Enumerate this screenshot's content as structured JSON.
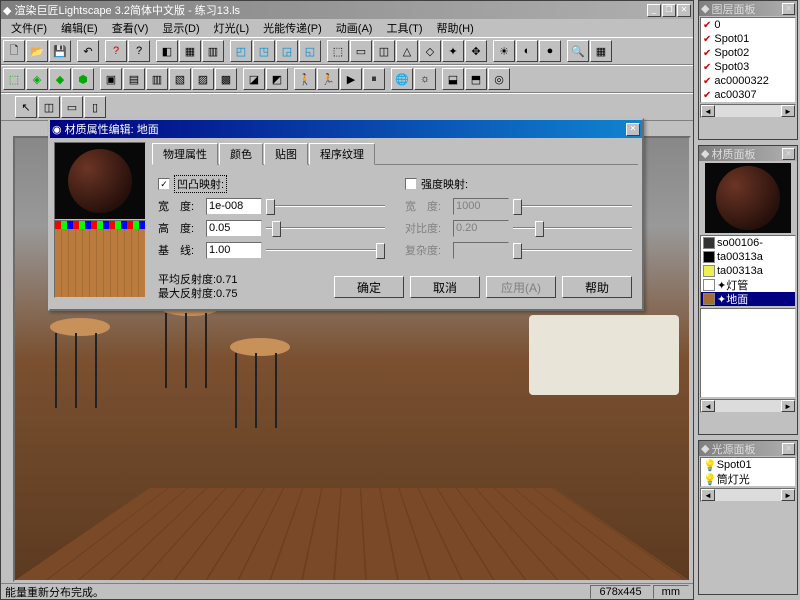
{
  "main": {
    "title": "渲染巨匠Lightscape 3.2简体中文版 - 练习13.ls",
    "menus": [
      "文件(F)",
      "编辑(E)",
      "查看(V)",
      "显示(D)",
      "灯光(L)",
      "光能传递(P)",
      "动画(A)",
      "工具(T)",
      "帮助(H)"
    ]
  },
  "status": {
    "text": "能量重新分布完成。",
    "dims": "678x445",
    "unit": "mm"
  },
  "panels": {
    "layers": {
      "title": "图层面板",
      "items": [
        "0",
        "Spot01",
        "Spot02",
        "Spot03",
        "ac0000322",
        "ac00307"
      ]
    },
    "materials": {
      "title": "材质面板",
      "items": [
        {
          "label": "so00106-",
          "color": "#333"
        },
        {
          "label": "ta00313a",
          "color": "#000"
        },
        {
          "label": "ta00313a",
          "color": "#ee5"
        },
        {
          "label": "灯管",
          "color": "#fff"
        },
        {
          "label": "地面",
          "color": "#a56d32",
          "selected": true
        }
      ]
    },
    "lights": {
      "title": "光源面板",
      "items": [
        "Spot01",
        "筒灯光"
      ]
    }
  },
  "dialog": {
    "title": "材质属性编辑: 地面",
    "tabs": [
      "物理属性",
      "颜色",
      "贴图",
      "程序纹理"
    ],
    "activeTab": 3,
    "left": {
      "bump_check": "凹凸映射:",
      "bump_checked": "✓",
      "width_label": "宽　度:",
      "width_val": "1e-008",
      "height_label": "高　度:",
      "height_val": "0.05",
      "base_label": "基　线:",
      "base_val": "1.00"
    },
    "right": {
      "intensity_check": "强度映射:",
      "width_label": "宽　度:",
      "width_val": "1000",
      "contrast_label": "对比度:",
      "contrast_val": "0.20",
      "complexity_label": "复杂度:",
      "complexity_val": ""
    },
    "footer": {
      "avg": "平均反射度:0.71",
      "max": "最大反射度:0.75",
      "ok": "确定",
      "cancel": "取消",
      "apply": "应用(A)",
      "help": "帮助"
    }
  }
}
